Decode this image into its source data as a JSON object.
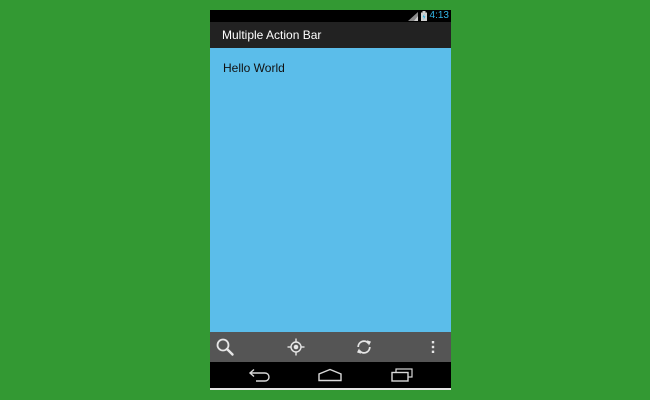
{
  "status_bar": {
    "time": "4:13",
    "icons": [
      "signal-icon",
      "battery-icon"
    ]
  },
  "action_bar": {
    "title": "Multiple Action Bar"
  },
  "content": {
    "text": "Hello World"
  },
  "split_action_bar": {
    "items": [
      {
        "icon": "search-icon"
      },
      {
        "icon": "locate-icon"
      },
      {
        "icon": "refresh-icon"
      },
      {
        "icon": "overflow-menu-icon"
      }
    ]
  },
  "nav_bar": {
    "items": [
      {
        "icon": "back-icon"
      },
      {
        "icon": "home-icon"
      },
      {
        "icon": "recent-apps-icon"
      }
    ]
  },
  "colors": {
    "background": "#339933",
    "content": "#5bbdea",
    "action_bar": "#222222",
    "split_bar": "#555555",
    "status_time": "#33b5e5"
  }
}
